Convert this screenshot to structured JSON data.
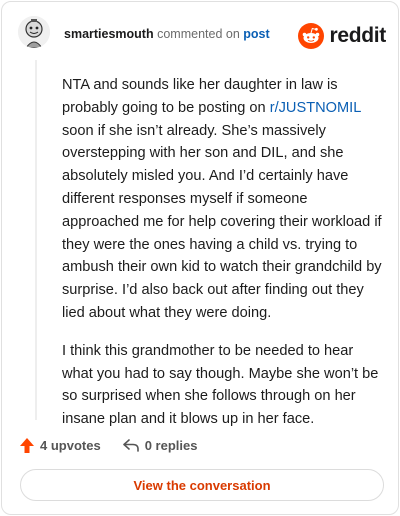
{
  "header": {
    "username": "smartiesmouth",
    "action_text": "commented on",
    "post_link": "post",
    "brand_name": "reddit",
    "brand_color": "#ff4500"
  },
  "comment": {
    "para1_before": "NTA and sounds like her daughter in law is probably going to be posting on ",
    "para1_link": "r/JUSTNOMIL",
    "para1_after": " soon if she isn’t already. She’s massively overstepping with her son and DIL, and she absolutely misled you. And I’d certainly have different responses myself if someone approached me for help covering their workload if they were the ones having a child vs. trying to ambush their own kid to watch their grandchild by surprise. I’d also back out after finding out they lied about what they were doing.",
    "para2": "I think this grandmother to be needed to hear what you had to say though. Maybe she won’t be so surprised when she follows through on her insane plan and it blows up in her face."
  },
  "actions": {
    "upvotes": "4 upvotes",
    "replies": "0 replies",
    "upvote_icon": "upvote-arrow-icon",
    "reply_icon": "reply-arrow-icon",
    "upvote_color": "#ff4500"
  },
  "cta": {
    "label": "View the conversation",
    "color": "#d93a00"
  }
}
